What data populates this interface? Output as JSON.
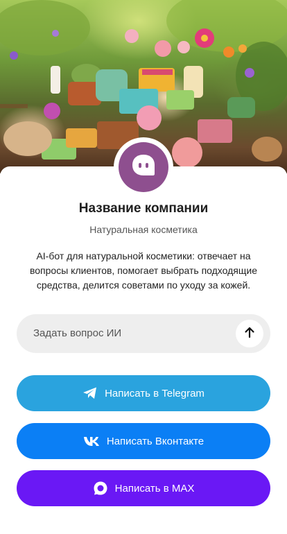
{
  "hero": {
    "image_alt": "natural cosmetics"
  },
  "company": {
    "name": "Название компании",
    "category": "Натуральная косметика",
    "description": "AI-бот для натуральной косметики: отвечает на вопросы клиентов, помогает выбрать подходящие средства, делится советами по уходу за кожей.",
    "avatar_icon": "chat-bot-icon",
    "avatar_color": "#8e4f8f"
  },
  "ask": {
    "placeholder": "Задать вопрос ИИ",
    "send_icon": "arrow-up-icon"
  },
  "buttons": {
    "telegram": {
      "label": "Написать в Telegram",
      "icon": "telegram-icon",
      "color": "#2aa3de"
    },
    "vk": {
      "label": "Написать Вконтакте",
      "icon": "vk-icon",
      "color": "#0b7ff5"
    },
    "max": {
      "label": "Написать в MAX",
      "icon": "max-icon",
      "color": "#6a18f5"
    }
  }
}
